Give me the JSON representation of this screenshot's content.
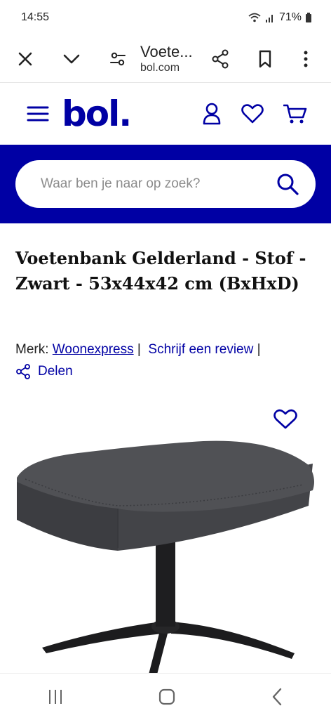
{
  "status": {
    "time": "14:55",
    "battery": "71%"
  },
  "browser": {
    "page_title": "Voete...",
    "domain": "bol.com"
  },
  "site": {
    "logo_text": "bol."
  },
  "search": {
    "placeholder": "Waar ben je naar op zoek?"
  },
  "product": {
    "title": "Voetenbank Gelderland - Stof - Zwart - 53x44x42 cm (BxHxD)",
    "brand_label": "Merk:",
    "brand_name": "Woonexpress",
    "separator": "|",
    "review_link": "Schrijf een review",
    "share_label": "Delen"
  },
  "colors": {
    "brand": "#0000a4",
    "fabric": "#4a4b4f",
    "metal": "#1c1c1e"
  },
  "icons": [
    "close-icon",
    "chevron-down-icon",
    "tune-icon",
    "share-icon",
    "bookmark-icon",
    "more-vert-icon",
    "menu-icon",
    "user-icon",
    "heart-icon",
    "cart-icon",
    "search-icon"
  ]
}
